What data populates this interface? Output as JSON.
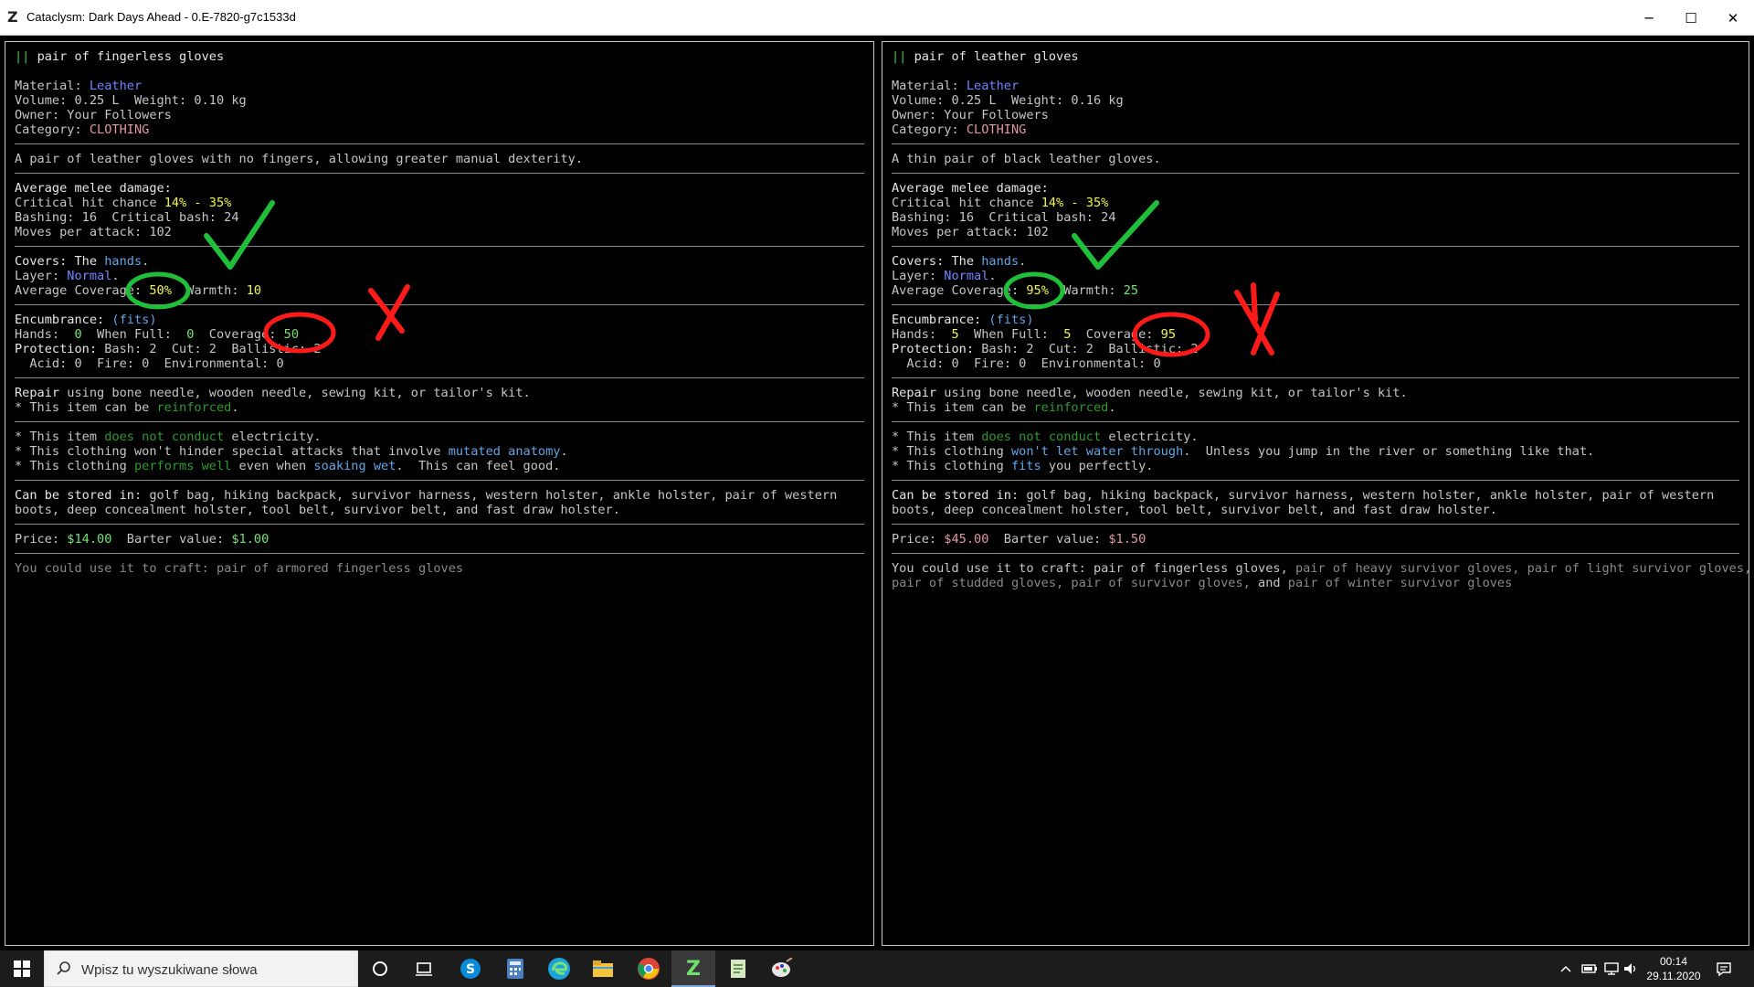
{
  "window": {
    "title": "Cataclysm: Dark Days Ahead - 0.E-7820-g7c1533d",
    "controls": {
      "minimize": "─",
      "maximize": "☐",
      "close": "✕"
    }
  },
  "left": {
    "header_bars": "||",
    "name": "pair of fingerless gloves",
    "material_label": "Material: ",
    "material": "Leather",
    "volume_weight": "Volume: 0.25 L  Weight: 0.10 kg",
    "owner": "Owner: Your Followers",
    "category_label": "Category: ",
    "category": "CLOTHING",
    "description": "A pair of leather gloves with no fingers, allowing greater manual dexterity.",
    "melee_header": "Average melee damage:",
    "crit_label": "Critical hit chance ",
    "crit": "14% - 35%",
    "bashing": "Bashing: 16  Critical bash: 24",
    "moves": "Moves per attack: 102",
    "covers_label": "Covers: The ",
    "covers": "hands",
    "covers_end": ".",
    "layer_label": "Layer: ",
    "layer": "Normal",
    "layer_end": ".",
    "coverage_label": "Average Coverage: ",
    "coverage": "50%",
    "warmth_label": "  Warmth: ",
    "warmth": "10",
    "enc_label": "Encumbrance: ",
    "enc_fits": "(fits)",
    "hands_label": "Hands:  ",
    "hands": "0",
    "full_label": "  When Full:  ",
    "full": "0",
    "cov2_label": "  Coverage: ",
    "cov2": "50",
    "protection_label": "Protection: ",
    "protection": "Bash: 2  Cut: 2  Ballistic: 2",
    "resist": "  Acid: 0  Fire: 0  Environmental: 0",
    "repair_label": "Repair",
    "repair": " using bone needle, wooden needle, sewing kit, or tailor's kit.",
    "reinforce_pre": "* This item can be ",
    "reinforce": "reinforced",
    "reinforce_end": ".",
    "note1_pre": "* This item ",
    "note1_hl": "does not conduct",
    "note1_post": " electricity.",
    "note2_pre": "* This clothing won't hinder special attacks that involve ",
    "note2_hl": "mutated anatomy",
    "note2_post": ".",
    "note3_pre": "* This clothing ",
    "note3_hl1": "performs well",
    "note3_mid": " even when ",
    "note3_hl2": "soaking wet",
    "note3_post": ".  This can feel good.",
    "stored_label": "Can be stored in",
    "stored1": ": golf bag, hiking backpack, survivor harness, western holster, ankle holster, pair of western",
    "stored2": "boots, deep concealment holster, tool belt, survivor belt, and fast draw holster.",
    "price_label": "Price: ",
    "price": "$14.00",
    "barter_label": "  Barter value: ",
    "barter": "$1.00",
    "craft_label": "You could use it to craft: ",
    "craft1": "pair of armored fingerless gloves",
    "craft2": ""
  },
  "right": {
    "header_bars": "||",
    "name": "pair of leather gloves",
    "material_label": "Material: ",
    "material": "Leather",
    "volume_weight": "Volume: 0.25 L  Weight: 0.16 kg",
    "owner": "Owner: Your Followers",
    "category_label": "Category: ",
    "category": "CLOTHING",
    "description": "A thin pair of black leather gloves.",
    "melee_header": "Average melee damage:",
    "crit_label": "Critical hit chance ",
    "crit": "14% - 35%",
    "bashing": "Bashing: 16  Critical bash: 24",
    "moves": "Moves per attack: 102",
    "covers_label": "Covers: The ",
    "covers": "hands",
    "covers_end": ".",
    "layer_label": "Layer: ",
    "layer": "Normal",
    "layer_end": ".",
    "coverage_label": "Average Coverage: ",
    "coverage": "95%",
    "warmth_label": "  Warmth: ",
    "warmth": "25",
    "enc_label": "Encumbrance: ",
    "enc_fits": "(fits)",
    "hands_label": "Hands:  ",
    "hands": "5",
    "full_label": "  When Full:  ",
    "full": "5",
    "cov2_label": "  Coverage: ",
    "cov2": "95",
    "protection_label": "Protection: ",
    "protection": "Bash: 2  Cut: 2  Ballistic: 2",
    "resist": "  Acid: 0  Fire: 0  Environmental: 0",
    "repair_label": "Repair",
    "repair": " using bone needle, wooden needle, sewing kit, or tailor's kit.",
    "reinforce_pre": "* This item can be ",
    "reinforce": "reinforced",
    "reinforce_end": ".",
    "note1_pre": "* This item ",
    "note1_hl": "does not conduct",
    "note1_post": " electricity.",
    "note2_pre": "* This clothing ",
    "note2_hl": "won't let water through",
    "note2_post": ".  Unless you jump in the river or something like that.",
    "note3_pre": "* This clothing ",
    "note3_hl1": "fits",
    "note3_mid": " you perfectly.",
    "note3_hl2": "",
    "note3_post": "",
    "stored_label": "Can be stored in",
    "stored1": ": golf bag, hiking backpack, survivor harness, western holster, ankle holster, pair of western",
    "stored2": "boots, deep concealment holster, tool belt, survivor belt, and fast draw holster.",
    "price_label": "Price: ",
    "price": "$45.00",
    "barter_label": "  Barter value: ",
    "barter": "$1.50",
    "craft_label": "You could use it to craft: ",
    "craft1": "pair of fingerless gloves, ",
    "craft1b": "pair of heavy survivor gloves, pair of light survivor gloves,",
    "craft2a": "pair of studded gloves, pair of survivor gloves, ",
    "craft2and": "and ",
    "craft2b": "pair of winter survivor gloves"
  },
  "annotations": {
    "checkmark_color": "#1fbf3a",
    "cross_color": "#ff1a1a",
    "circle_good_color": "#1fbf3a",
    "circle_bad_color": "#ff1a1a"
  },
  "taskbar": {
    "search_placeholder": "Wpisz tu wyszukiwane słowa",
    "time": "00:14",
    "date": "29.11.2020",
    "icons": [
      "windows-icon",
      "cortana-icon",
      "task-view-icon",
      "skype-icon",
      "calculator-icon",
      "edge-icon",
      "file-explorer-icon",
      "chrome-icon",
      "cataclysm-icon",
      "notepad-icon",
      "paint-icon"
    ]
  }
}
